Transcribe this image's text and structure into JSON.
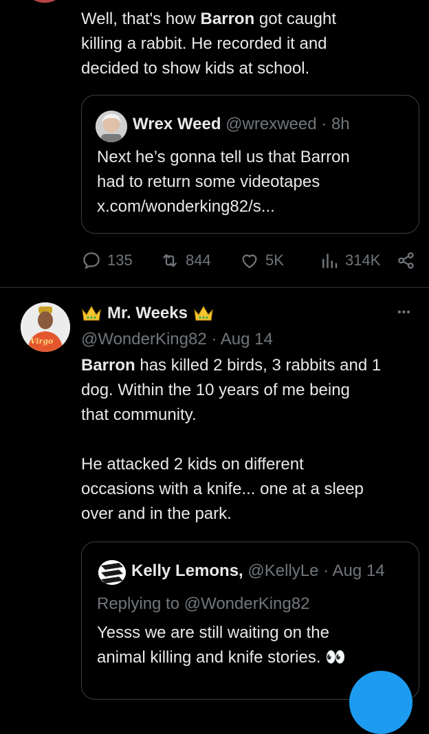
{
  "tweet1": {
    "text_lines": [
      {
        "pre": "Well, that's how ",
        "bold": "Barron",
        "post": " got caught"
      },
      {
        "pre": "killing a rabbit. He recorded it and",
        "bold": "",
        "post": ""
      },
      {
        "pre": "decided to show kids at school.",
        "bold": "",
        "post": ""
      }
    ],
    "quote": {
      "name": "Wrex Weed",
      "handle": "@wrexweed",
      "sep": "·",
      "time": "8h",
      "lines": [
        "Next he’s gonna tell us that Barron",
        "had to return some videotapes",
        "x.com/wonderking82/s..."
      ]
    },
    "actions": {
      "reply": "135",
      "retweet": "844",
      "like": "5K",
      "views": "314K"
    }
  },
  "tweet2": {
    "name": "Mr. Weeks",
    "handle": "@WonderKing82",
    "sep": "·",
    "time": "Aug 14",
    "more_label": "•••",
    "avatar_text": "Virgo",
    "text_lines": [
      {
        "pre": "",
        "bold": "Barron",
        "post": " has killed 2 birds, 3 rabbits and 1"
      },
      {
        "pre": "dog. Within the 10 years of me being",
        "bold": "",
        "post": ""
      },
      {
        "pre": "that community.",
        "bold": "",
        "post": ""
      },
      {
        "pre": "He attacked 2 kids on different",
        "bold": "",
        "post": ""
      },
      {
        "pre": "occasions with a knife... one at a sleep",
        "bold": "",
        "post": ""
      },
      {
        "pre": "over and in the park.",
        "bold": "",
        "post": ""
      }
    ],
    "quote": {
      "name": "Kelly Lemons,",
      "handle": "@KellyLe",
      "sep": "·",
      "time": "Aug 14",
      "replying": "Replying to @WonderKing82",
      "lines": [
        "Yesss we are still waiting on the",
        "animal killing and knife stories."
      ],
      "emoji": "👀"
    }
  },
  "colors": {
    "background": "#000000",
    "text": "#e7e9ea",
    "muted": "#71767b",
    "border": "#3b3f44",
    "accent": "#1d9bf0",
    "crown": "#f4c430"
  }
}
